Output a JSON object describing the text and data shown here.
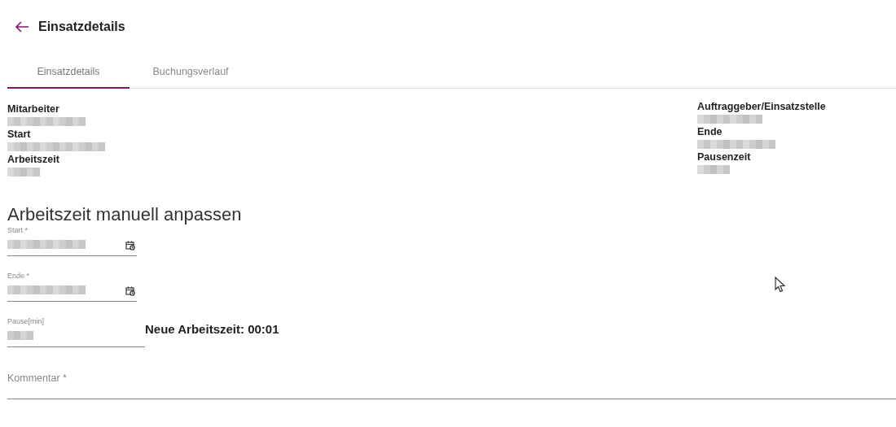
{
  "header": {
    "title": "Einsatzdetails"
  },
  "tabs": [
    {
      "label": "Einsatzdetails",
      "selected": true
    },
    {
      "label": "Buchungsverlauf",
      "selected": false
    }
  ],
  "details_left": [
    {
      "label": "Mitarbeiter",
      "value_redacted": true
    },
    {
      "label": "Start",
      "value_redacted": true
    },
    {
      "label": "Arbeitszeit",
      "value_redacted": true
    }
  ],
  "details_right": [
    {
      "label": "Auftraggeber/Einsatzstelle",
      "value_redacted": true
    },
    {
      "label": "Ende",
      "value_redacted": true
    },
    {
      "label": "Pausenzeit",
      "value_redacted": true
    }
  ],
  "form": {
    "title": "Arbeitszeit manuell anpassen",
    "fields": [
      {
        "label": "Start *",
        "kind": "datetime",
        "value_redacted": true
      },
      {
        "label": "Ende *",
        "kind": "datetime",
        "value_redacted": true
      },
      {
        "label": "Pause[min]",
        "kind": "number",
        "value_redacted": true
      }
    ],
    "result": "Neue Arbeitszeit: 00:01",
    "comment": {
      "placeholder": "Kommentar *"
    }
  }
}
